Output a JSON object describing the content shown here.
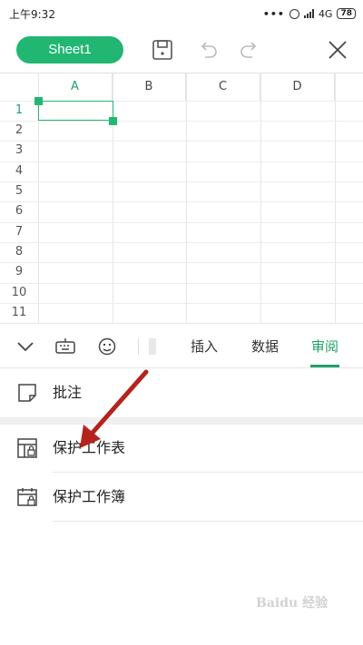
{
  "status_bar": {
    "time": "上午9:32",
    "network": "4G",
    "battery": "78"
  },
  "top_bar": {
    "sheet_name": "Sheet1"
  },
  "grid": {
    "columns": [
      "A",
      "B",
      "C",
      "D"
    ],
    "rows": [
      "1",
      "2",
      "3",
      "4",
      "5",
      "6",
      "7",
      "8",
      "9",
      "10",
      "11"
    ],
    "selected_cell": "A1"
  },
  "ribbon": {
    "tabs": [
      "插入",
      "数据",
      "审阅"
    ],
    "active_tab": "审阅"
  },
  "menu": {
    "items": [
      "批注",
      "保护工作表",
      "保护工作簿"
    ]
  },
  "colors": {
    "accent": "#22b673",
    "annotation_arrow": "#b5231c"
  },
  "watermark": "Baidu 经验"
}
